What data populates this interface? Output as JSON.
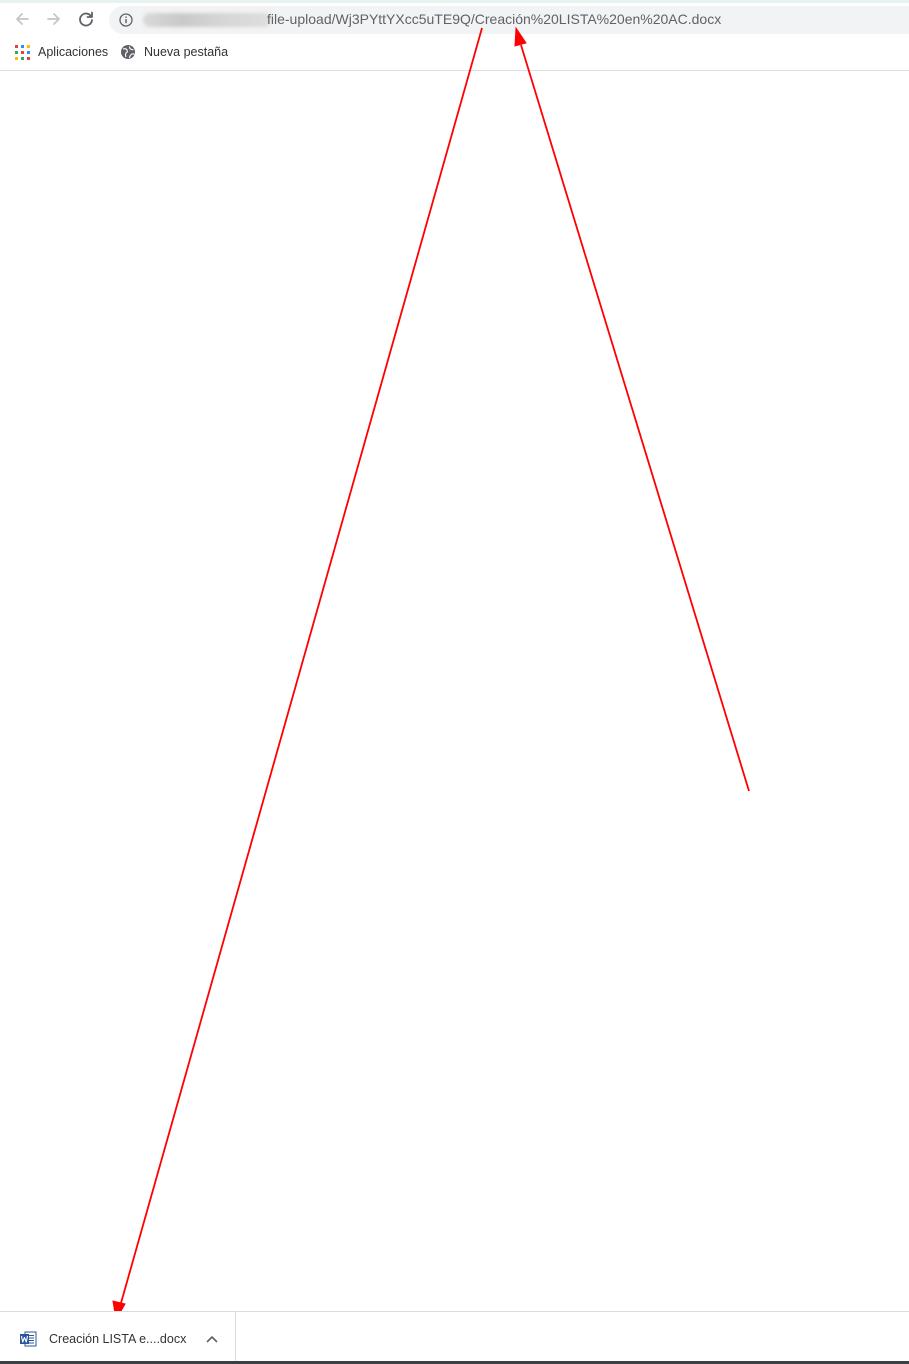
{
  "toolbar": {
    "back_icon": "arrow-left-icon",
    "forward_icon": "arrow-right-icon",
    "reload_icon": "reload-icon"
  },
  "omnibox": {
    "info_icon": "info-icon",
    "url_visible": "file-upload/Wj3PYttYXcc5uTE9Q/Creación%20LISTA%20en%20AC.docx"
  },
  "bookmarks": {
    "items": [
      {
        "label": "Aplicaciones",
        "icon": "apps-grid-icon"
      },
      {
        "label": "Nueva pestaña",
        "icon": "globe-icon"
      }
    ]
  },
  "download_shelf": {
    "item": {
      "filename": "Creación LISTA e....docx",
      "icon": "word-document-icon",
      "menu_icon": "chevron-up-icon"
    }
  },
  "colors": {
    "annotation_arrow": "#ff0000",
    "omnibox_bg": "#f1f3f4",
    "text": "#333333",
    "url_text": "#5f6368"
  }
}
